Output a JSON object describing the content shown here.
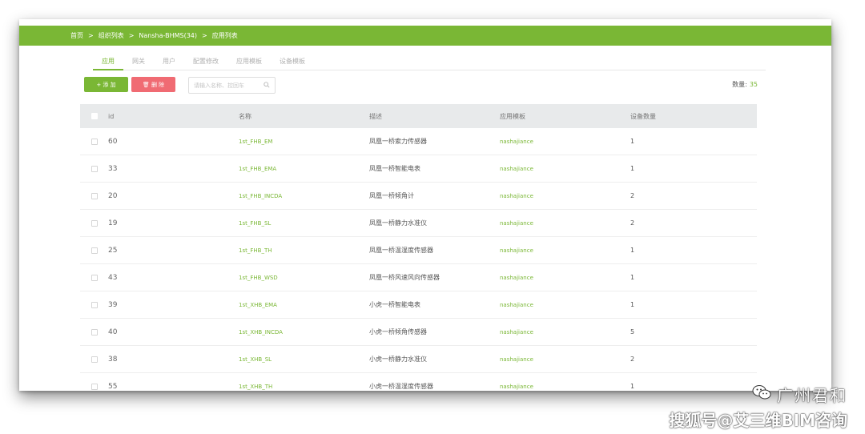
{
  "breadcrumb": [
    "首页",
    "组织列表",
    "Nansha-BHMS(34)",
    "应用列表"
  ],
  "breadcrumb_sep": ">",
  "tabs": [
    {
      "label": "应用",
      "active": true
    },
    {
      "label": "网关",
      "active": false
    },
    {
      "label": "用户",
      "active": false
    },
    {
      "label": "配置修改",
      "active": false
    },
    {
      "label": "应用模板",
      "active": false
    },
    {
      "label": "设备模板",
      "active": false
    }
  ],
  "toolbar": {
    "add_label": "+ 添 加",
    "delete_label": "🗑 删 除",
    "search_placeholder": "请输入名称、控回车",
    "count_label": "数量:",
    "count_value": "35"
  },
  "table": {
    "columns": [
      "id",
      "名称",
      "描述",
      "应用模板",
      "设备数量"
    ],
    "rows": [
      {
        "id": "60",
        "name": "1st_FHB_EM",
        "desc": "凤凰一桥索力传感器",
        "tpl": "nashajiance",
        "dev": "1"
      },
      {
        "id": "33",
        "name": "1st_FHB_EMA",
        "desc": "凤凰一桥智能电表",
        "tpl": "nashajiance",
        "dev": "1"
      },
      {
        "id": "20",
        "name": "1st_FHB_INCDA",
        "desc": "凤凰一桥倾角计",
        "tpl": "nashajiance",
        "dev": "2"
      },
      {
        "id": "19",
        "name": "1st_FHB_SL",
        "desc": "凤凰一桥静力水准仪",
        "tpl": "nashajiance",
        "dev": "2"
      },
      {
        "id": "25",
        "name": "1st_FHB_TH",
        "desc": "凤凰一桥温湿度传感器",
        "tpl": "nashajiance",
        "dev": "1"
      },
      {
        "id": "43",
        "name": "1st_FHB_WSD",
        "desc": "凤凰一桥风速风向传感器",
        "tpl": "nashajiance",
        "dev": "1"
      },
      {
        "id": "39",
        "name": "1st_XHB_EMA",
        "desc": "小虎一桥智能电表",
        "tpl": "nashajiance",
        "dev": "1"
      },
      {
        "id": "40",
        "name": "1st_XHB_INCDA",
        "desc": "小虎一桥倾角传感器",
        "tpl": "nashajiance",
        "dev": "5"
      },
      {
        "id": "38",
        "name": "1st_XHB_SL",
        "desc": "小虎一桥静力水准仪",
        "tpl": "nashajiance",
        "dev": "2"
      },
      {
        "id": "55",
        "name": "1st_XHB_TH",
        "desc": "小虎一桥温湿度传感器",
        "tpl": "nashajiance",
        "dev": "1"
      }
    ]
  },
  "watermark": {
    "line1": "广州君和",
    "line2": "搜狐号@艾三维BIM咨询"
  },
  "colors": {
    "accent": "#7ab735",
    "danger": "#f06b73",
    "header_bg": "#e8eaeb"
  },
  "icons": {
    "search": "search-icon",
    "delete": "trash-icon",
    "wechat": "wechat-icon"
  }
}
